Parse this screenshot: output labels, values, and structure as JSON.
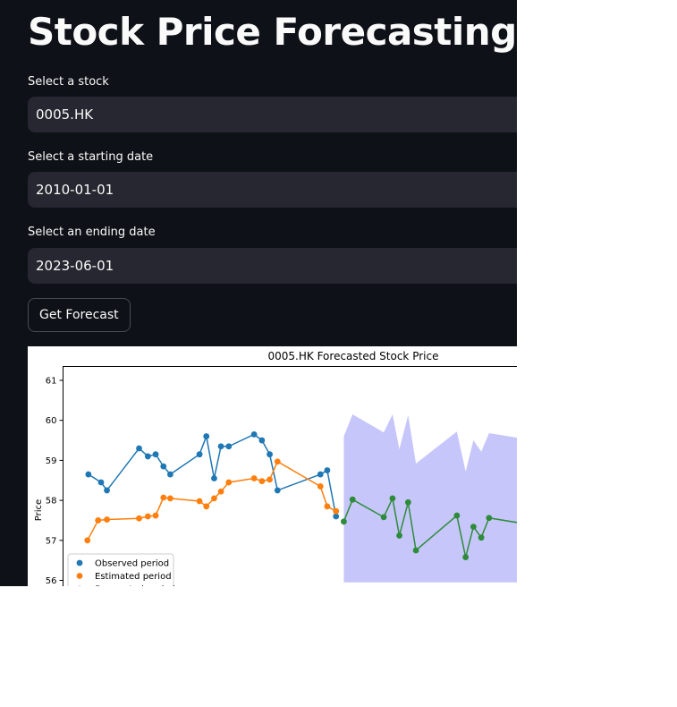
{
  "app": {
    "title": "Stock Price Forecasting using"
  },
  "form": {
    "stock_label": "Select a stock",
    "stock_value": "0005.HK",
    "start_label": "Select a starting date",
    "start_value": "2010-01-01",
    "end_label": "Select an ending date",
    "end_value": "2023-06-01",
    "button_label": "Get Forecast"
  },
  "theme": {
    "background": "#0e1117",
    "input_background": "#262730",
    "text": "#fafafa"
  },
  "chart_data": {
    "type": "line",
    "title": "0005.HK Forecasted Stock Price",
    "xlabel": "",
    "ylabel": "Price",
    "ylim": [
      55.95,
      61.3
    ],
    "xlim": [
      0,
      46
    ],
    "yticks": [
      56,
      57,
      58,
      59,
      60,
      61
    ],
    "grid": false,
    "legend_position": "bottom-left",
    "series": [
      {
        "name": "Observed period",
        "color": "#1f77b4",
        "points": [
          [
            2.6,
            58.65
          ],
          [
            3.9,
            58.45
          ],
          [
            4.5,
            58.25
          ],
          [
            7.8,
            59.3
          ],
          [
            8.7,
            59.1
          ],
          [
            9.5,
            59.15
          ],
          [
            10.3,
            58.85
          ],
          [
            11.0,
            58.65
          ],
          [
            14.0,
            59.15
          ],
          [
            14.7,
            59.6
          ],
          [
            15.5,
            58.55
          ],
          [
            16.2,
            59.35
          ],
          [
            17.0,
            59.35
          ],
          [
            19.6,
            59.65
          ],
          [
            20.4,
            59.5
          ],
          [
            21.2,
            59.15
          ],
          [
            22.0,
            58.25
          ],
          [
            26.4,
            58.65
          ],
          [
            27.1,
            58.75
          ],
          [
            28.0,
            57.6
          ]
        ]
      },
      {
        "name": "Estimated period",
        "color": "#ff7f0e",
        "points": [
          [
            2.5,
            57.0
          ],
          [
            3.6,
            57.5
          ],
          [
            4.5,
            57.52
          ],
          [
            7.8,
            57.55
          ],
          [
            8.7,
            57.6
          ],
          [
            9.5,
            57.62
          ],
          [
            10.3,
            58.07
          ],
          [
            11.0,
            58.05
          ],
          [
            14.0,
            57.98
          ],
          [
            14.7,
            57.85
          ],
          [
            15.5,
            58.05
          ],
          [
            16.2,
            58.22
          ],
          [
            17.0,
            58.45
          ],
          [
            19.6,
            58.55
          ],
          [
            20.4,
            58.48
          ],
          [
            21.2,
            58.52
          ],
          [
            22.0,
            58.97
          ],
          [
            26.4,
            58.35
          ],
          [
            27.1,
            57.85
          ],
          [
            28.0,
            57.73
          ]
        ]
      },
      {
        "name": "Forecasted period",
        "color": "#2e8b3a",
        "points": [
          [
            28.8,
            57.47
          ],
          [
            29.7,
            58.02
          ],
          [
            32.9,
            57.58
          ],
          [
            33.8,
            58.05
          ],
          [
            34.5,
            57.12
          ],
          [
            35.4,
            57.95
          ],
          [
            36.2,
            56.75
          ],
          [
            40.4,
            57.62
          ],
          [
            41.3,
            56.58
          ],
          [
            42.1,
            57.34
          ],
          [
            42.9,
            57.07
          ],
          [
            43.7,
            57.56
          ],
          [
            47.0,
            57.43
          ]
        ]
      }
    ],
    "confidence_band": {
      "color": "#c6c6fb",
      "upper": [
        [
          28.8,
          59.6
        ],
        [
          29.7,
          60.15
        ],
        [
          32.9,
          59.7
        ],
        [
          33.8,
          60.15
        ],
        [
          34.5,
          59.28
        ],
        [
          35.4,
          60.13
        ],
        [
          36.2,
          58.92
        ],
        [
          40.4,
          59.72
        ],
        [
          41.3,
          58.72
        ],
        [
          42.1,
          59.5
        ],
        [
          42.9,
          59.22
        ],
        [
          43.7,
          59.68
        ],
        [
          47.0,
          59.55
        ]
      ],
      "lower_value": 55.95
    }
  }
}
